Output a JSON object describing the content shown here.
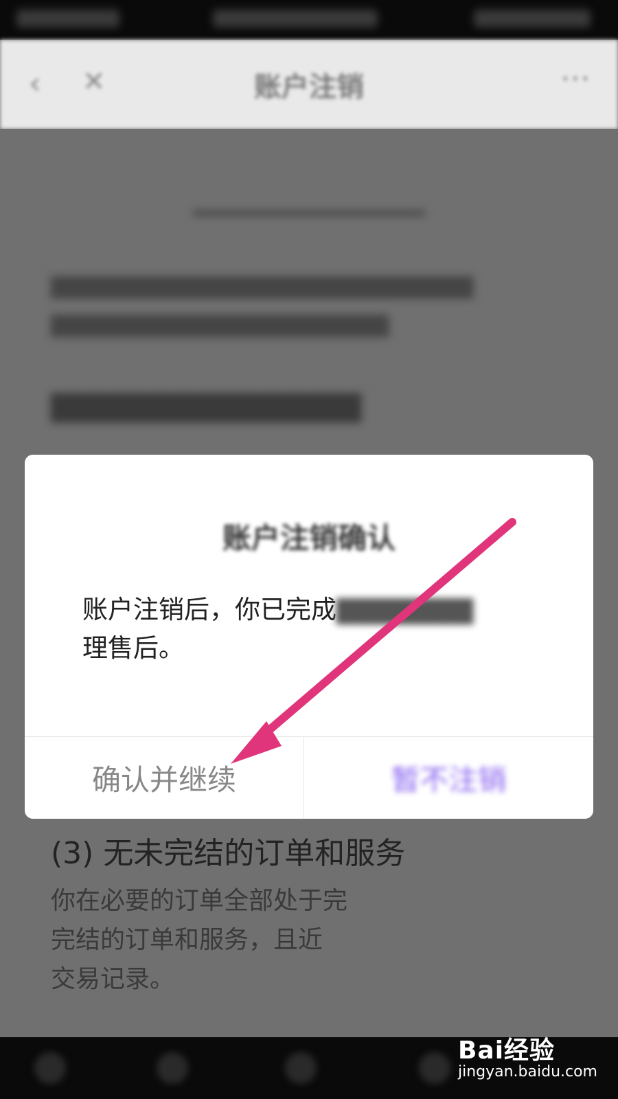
{
  "status_bar": {},
  "app_bar": {
    "title": "账户注销",
    "back_icon": "chevron-left-icon",
    "close_icon": "close-icon",
    "more_icon": "more-icon"
  },
  "page": {
    "section3_title": "(3) 无未完结的订单和服务",
    "section3_body_clear": "你在必要的订单全部处于完",
    "section3_body_line2": "完结的订单和服务，且近",
    "section3_body_line3": "交易记录。"
  },
  "dialog": {
    "title": "账户注销确认",
    "body_line1": "账户注销后，你已完成",
    "body_line2": "理售后。",
    "confirm_label": "确认并继续",
    "cancel_label": "暂不注销"
  },
  "watermark": {
    "logo": "Bai经验",
    "url": "jingyan.baidu.com"
  },
  "colors": {
    "accent": "#8a63f0",
    "annotation_arrow": "#e0357a"
  }
}
